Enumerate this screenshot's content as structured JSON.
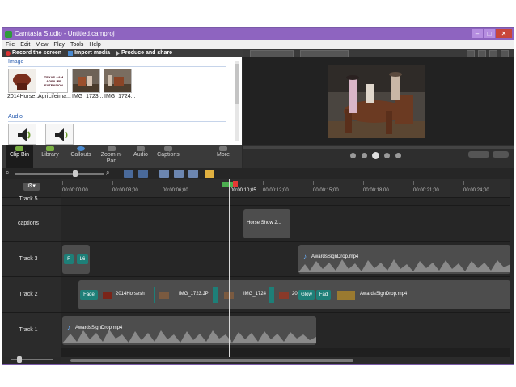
{
  "window": {
    "title": "Camtasia Studio - Untitled.camproj"
  },
  "menu": [
    "File",
    "Edit",
    "View",
    "Play",
    "Tools",
    "Help"
  ],
  "toolbar": {
    "record": "Record the screen",
    "import": "Import media",
    "produce": "Produce and share"
  },
  "clip_bin": {
    "image_label": "Image",
    "audio_label": "Audio",
    "images": [
      {
        "label": "2014Horse..."
      },
      {
        "label": "AgriLifeima..."
      },
      {
        "label": "IMG_1723..."
      },
      {
        "label": "IMG_1724..."
      }
    ],
    "logo_text": "TEXAS A&M AGRILIFE EXTENSION"
  },
  "tabs": [
    {
      "label": "Clip Bin",
      "active": true
    },
    {
      "label": "Library",
      "active": false
    },
    {
      "label": "Callouts",
      "active": false
    },
    {
      "label": "Zoom-n-Pan",
      "active": false
    },
    {
      "label": "Audio",
      "active": false
    },
    {
      "label": "Captions",
      "active": false
    },
    {
      "label": "More",
      "active": false
    }
  ],
  "timeline": {
    "ruler": [
      "00:00:00;00",
      "00:00:03;00",
      "00:00:06;00",
      "00:00:10;05",
      "00:00:12;00",
      "00:00:15;00",
      "00:00:18;00",
      "00:00:21;00",
      "00:00:24;00"
    ],
    "tracks": [
      {
        "name": "Track 5"
      },
      {
        "name": "captions"
      },
      {
        "name": "Track 3"
      },
      {
        "name": "Track 2"
      },
      {
        "name": "Track 1"
      }
    ],
    "caption_clip": "Horse Show 2...",
    "track3_clip": "AwardsSignDrop.mp4",
    "track3_trans": [
      "F",
      "L6"
    ],
    "track2_items": {
      "fade": "Fade",
      "clip1": "2014Horsesh",
      "clip2": "IMG_1723.JP",
      "clip3": "IMG_1724",
      "clip4": "20",
      "glow": "Glow",
      "fad": "Fad",
      "clip5": "AwardsSignDrop.mp4"
    },
    "track1_clip": "AwardsSignDrop.mp4"
  },
  "colors": {
    "titlebar": "#8e64c0",
    "transition": "#1e7f78",
    "link": "#2a5db0"
  }
}
